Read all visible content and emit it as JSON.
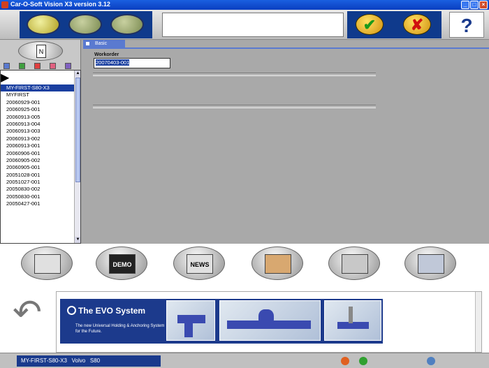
{
  "window": {
    "title": "Car-O-Soft Vision X3 version 3.12"
  },
  "toolbar": {
    "ok_symbol": "✔",
    "cancel_symbol": "✘",
    "help_symbol": "?"
  },
  "left_panel": {
    "new_label": "N",
    "items": [
      "MY-FIRST-S80-X3",
      "MYFIRST",
      "20060929-001",
      "20060925-001",
      "20060913-005",
      "20060913-004",
      "20060913-003",
      "20060913-002",
      "20060913-001",
      "20060906-001",
      "20060905-002",
      "20060905-001",
      "20051028-001",
      "20051027-001",
      "20050830-002",
      "20050830-001",
      "20050427-001"
    ]
  },
  "main": {
    "tab_label": "Basic",
    "workorder_label": "Workorder",
    "workorder_value": "20070403-001"
  },
  "bottom_buttons": {
    "demo_label": "DEMO",
    "news_label": "NEWS"
  },
  "banner": {
    "title": "The EVO System",
    "subtitle": "The new Universal Holding & Anchoring System for the Future."
  },
  "status": {
    "vehicle": "MY-FIRST-S80-X3   Volvo   S80"
  },
  "colors": {
    "accent": "#1a3a8c",
    "background": "#a9a9a9"
  }
}
